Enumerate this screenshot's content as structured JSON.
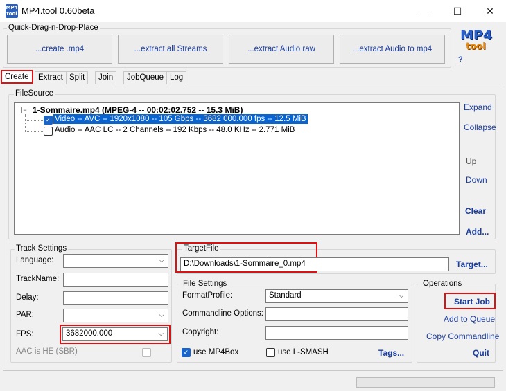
{
  "window": {
    "title": "MP4.tool 0.60beta",
    "icon_label": "MP4 tool",
    "minimize": "—",
    "maximize": "☐",
    "close": "✕"
  },
  "quick_drag": {
    "title": "Quick-Drag-n-Drop-Place",
    "buttons": [
      "...create .mp4",
      "...extract all Streams",
      "...extract Audio raw",
      "...extract Audio to mp4"
    ]
  },
  "logo": {
    "line1": "MP4",
    "line2": "tool"
  },
  "help": "?",
  "tabs": [
    "Create",
    "Extract",
    "Split",
    "Join",
    "JobQueue",
    "Log"
  ],
  "filesource": {
    "title": "FileSource",
    "expander": "−",
    "root": "1-Sommaire.mp4 (MPEG-4 -- 00:02:02.752 -- 15.3 MiB)",
    "tracks": [
      {
        "label": "Video -- AVC -- 1920x1080 -- 105 Gbps -- 3682 000.000 fps -- 12.5 MiB",
        "checked": true,
        "selected": true
      },
      {
        "label": "Audio -- AAC LC -- 2 Channels -- 192 Kbps -- 48.0 KHz -- 2.771 MiB",
        "checked": false,
        "selected": false
      }
    ],
    "buttons": {
      "expand": "Expand",
      "collapse": "Collapse",
      "up": "Up",
      "down": "Down",
      "clear": "Clear",
      "add": "Add..."
    }
  },
  "track_settings": {
    "title": "Track Settings",
    "language_label": "Language:",
    "language_value": "",
    "trackname_label": "TrackName:",
    "trackname_value": "",
    "delay_label": "Delay:",
    "delay_value": "",
    "par_label": "PAR:",
    "par_value": "",
    "fps_label": "FPS:",
    "fps_value": "3682000.000",
    "aac_he_label": "AAC is HE (SBR)"
  },
  "target_file": {
    "title": "TargetFile",
    "path": "D:\\Downloads\\1-Sommaire_0.mp4",
    "button": "Target..."
  },
  "file_settings": {
    "title": "File Settings",
    "format_profile_label": "FormatProfile:",
    "format_profile_value": "Standard",
    "cmdline_label": "Commandline Options:",
    "cmdline_value": "",
    "copyright_label": "Copyright:",
    "copyright_value": "",
    "use_mp4box_label": "use MP4Box",
    "use_mp4box": true,
    "use_lsmash_label": "use L-SMASH",
    "use_lsmash": false,
    "tags_button": "Tags..."
  },
  "operations": {
    "title": "Operations",
    "start_job": "Start Job",
    "add_queue": "Add to Queue",
    "copy_cmd": "Copy Commandline",
    "quit": "Quit"
  },
  "chevron": "⌵",
  "checkmark": "✓"
}
